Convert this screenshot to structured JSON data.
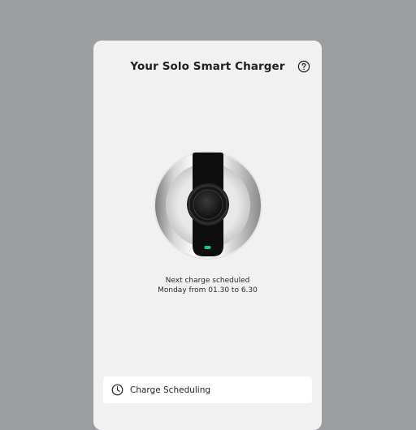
{
  "header": {
    "title": "Your Solo Smart Charger",
    "help_icon": "question-circle-icon"
  },
  "charger": {
    "led_color": "#19c39a"
  },
  "status": {
    "line1": "Next charge scheduled",
    "line2": "Monday from 01.30 to 6.30"
  },
  "actions": {
    "schedule_label": "Charge Scheduling",
    "schedule_icon": "clock-icon"
  }
}
